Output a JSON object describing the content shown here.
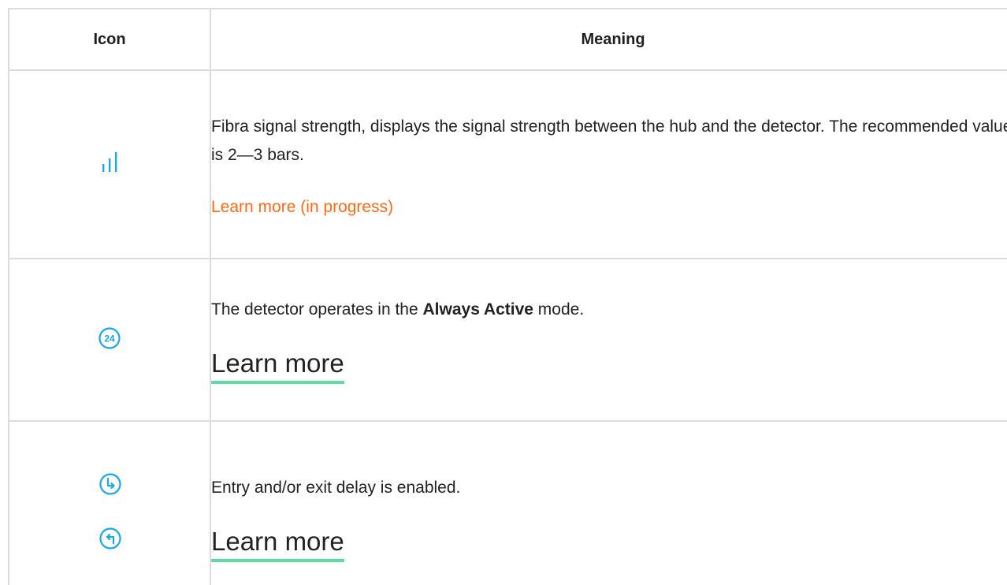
{
  "table": {
    "headers": {
      "icon": "Icon",
      "meaning": "Meaning"
    },
    "rows": [
      {
        "icon": "signal-strength-icon",
        "text_before": "Fibra signal strength, displays the signal strength between the hub and the detector. The recommended value is 2—3 bars.",
        "link": "Learn more (in progress)"
      },
      {
        "icon": "always-active-24-icon",
        "icon_label": "24",
        "text_before": "The detector operates in the ",
        "text_bold": "Always Active",
        "text_after": " mode.",
        "link": "Learn more"
      },
      {
        "icons": [
          "entry-delay-icon",
          "exit-delay-icon"
        ],
        "text_before": "Entry and/or exit delay is enabled.",
        "link": "Learn more"
      }
    ]
  },
  "colors": {
    "icon": "#1aa8e8",
    "link_orange": "#ff6a13",
    "link_underline": "#5fdba6",
    "border": "#dcdcdc",
    "text": "#222222"
  }
}
